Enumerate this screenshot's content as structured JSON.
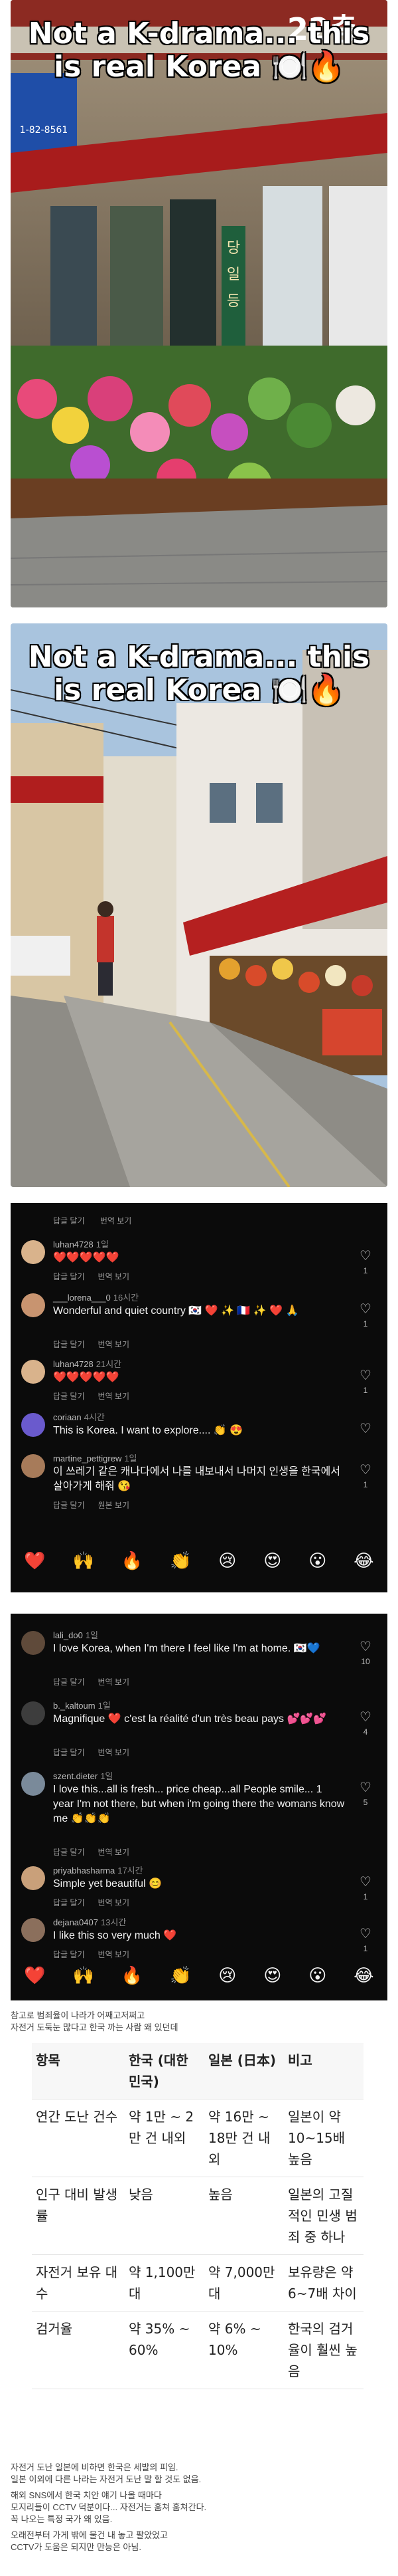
{
  "overlay_text": "Not a K-drama... this is real Korea 🍽️🔥",
  "photo1": {
    "sign_top": "22층",
    "phone": "1-82-8561",
    "shop_vertical": "당일 등홍 바"
  },
  "comments1": {
    "top_actions": {
      "reply": "답글 달기",
      "translate": "번역 보기"
    },
    "items": [
      {
        "user": "luhan4728",
        "time": "1일",
        "text": "❤️❤️❤️❤️❤️",
        "likes": "1",
        "actions": [
          "답글 달기",
          "번역 보기"
        ]
      },
      {
        "user": "___lorena___0",
        "time": "16시간",
        "text": "Wonderful and quiet country 🇰🇷 ❤️ ✨ 🇫🇷 ✨ ❤️ 🙏",
        "likes": "1",
        "actions": [
          "답글 달기",
          "번역 보기"
        ]
      },
      {
        "user": "luhan4728",
        "time": "21시간",
        "text": "❤️❤️❤️❤️❤️",
        "likes": "1",
        "actions": [
          "답글 달기",
          "번역 보기"
        ]
      },
      {
        "user": "coriaan",
        "time": "4시간",
        "text": "This is Korea. I want to explore.... 👏 😍",
        "likes": "",
        "actions": [
          "답글 달기",
          "번역 보기"
        ]
      },
      {
        "user": "martine_pettigrew",
        "time": "1일",
        "text": "이 쓰레기 같은 캐나다에서 나를 내보내서 나머지 인생을 한국에서 살아가게 해줘 😘",
        "likes": "1",
        "actions": [
          "답글 달기",
          "원본 보기"
        ]
      }
    ],
    "emojis": [
      "❤️",
      "🙌",
      "🔥",
      "👏",
      "😢",
      "😍",
      "😮",
      "😂"
    ]
  },
  "comments2": {
    "items": [
      {
        "user": "lali_do0",
        "time": "1일",
        "text": "I love Korea, when I'm there I feel like I'm at home. 🇰🇷💙",
        "likes": "10",
        "actions": [
          "답글 달기",
          "번역 보기"
        ]
      },
      {
        "user": "b._kaltoum",
        "time": "1일",
        "text": "Magnifique ❤️ c'est la réalité d'un très beau pays 💕💕💕",
        "likes": "4",
        "actions": [
          "답글 달기",
          "번역 보기"
        ]
      },
      {
        "user": "szent.dieter",
        "time": "1일",
        "text": "I love this...all is fresh... price cheap...all People smile... 1 year I'm not there, but when i'm going there the womans know me 👏👏👏",
        "likes": "5",
        "actions": [
          "답글 달기",
          "번역 보기"
        ]
      },
      {
        "user": "priyabhasharma",
        "time": "17시간",
        "text": "Simple yet beautiful 😊",
        "likes": "1",
        "actions": [
          "답글 달기",
          "번역 보기"
        ]
      },
      {
        "user": "dejana0407",
        "time": "13시간",
        "text": "I like this so very much ❤️",
        "likes": "1",
        "actions": [
          "답글 달기",
          "번역 보기"
        ]
      }
    ],
    "emojis": [
      "❤️",
      "🙌",
      "🔥",
      "👏",
      "😢",
      "😍",
      "😮",
      "😂"
    ]
  },
  "note_top": [
    "참고로 범죄율이 나라가 어째고저쩌고",
    "자전거 도둑눈 많다고 한국 까는 사람 왜 있던데"
  ],
  "table": {
    "headers": [
      "항목",
      "한국 (대한민국)",
      "일본 (日本)",
      "비고"
    ],
    "rows": [
      [
        "연간 도난 건수",
        "약 1만 ~ 2만 건 내외",
        "약 16만 ~ 18만 건 내외",
        "일본이 약 10~15배 높음"
      ],
      [
        "인구 대비 발생률",
        "낮음",
        "높음",
        "일본의 고질적인 민생 범죄 중 하나"
      ],
      [
        "자전거 보유 대수",
        "약 1,100만 대",
        "약 7,000만 대",
        "보유량은 약 6~7배 차이"
      ],
      [
        "검거율",
        "약 35% ~ 60%",
        "약 6% ~ 10%",
        "한국의 검거율이 훨씬 높음"
      ]
    ]
  },
  "note_bottom": [
    "자전거 도난 일본에 비하면 한국은 세발의 피임.",
    "일본 이외에 다른 나라는 자전거 도난 말 할 것도 없음.",
    "",
    "해외 SNS에서 한국 치안 얘기 나올 때마다",
    "모지리들이 CCTV 덕분이다... 자전거는 훔쳐 훔쳐간다.",
    "꼭 나오는 특정 국가 왜 있음.",
    "",
    "오래전부터 가게 밖에 물건 내 놓고 팔았었고",
    "CCTV가 도움은 되지만 만능은 아님."
  ]
}
